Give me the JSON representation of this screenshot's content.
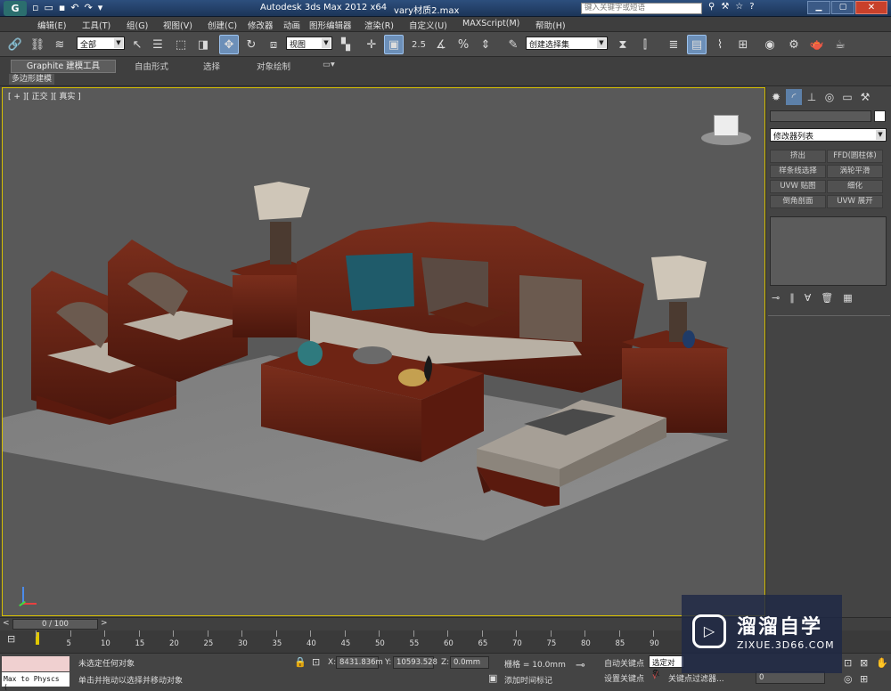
{
  "titlebar": {
    "app_title": "Autodesk 3ds Max  2012 x64",
    "file_name": "vary材质2.max",
    "search_placeholder": "键入关键字或短语"
  },
  "menu": {
    "items": [
      "编辑(E)",
      "工具(T)",
      "组(G)",
      "视图(V)",
      "创建(C)",
      "修改器",
      "动画",
      "图形编辑器",
      "渲染(R)",
      "自定义(U)",
      "MAXScript(M)",
      "帮助(H)"
    ]
  },
  "toolbar": {
    "selection_filter": "全部",
    "coord_system": "视图",
    "named_selection": "创建选择集",
    "snap_value": "2.5"
  },
  "ribbon": {
    "tabs": [
      "Graphite 建模工具",
      "自由形式",
      "选择",
      "对象绘制"
    ],
    "active_tab": "Graphite 建模工具",
    "sub_label": "多边形建模"
  },
  "viewport": {
    "label": "[ + ][ 正交 ][ 真实 ]"
  },
  "command_panel": {
    "modifier_list": "修改器列表",
    "buttons": [
      "挤出",
      "FFD(圆柱体)",
      "样条线选择",
      "涡轮平滑",
      "UVW 贴图",
      "细化",
      "倒角剖面",
      "UVW 展开"
    ]
  },
  "timeline": {
    "frame": "0 / 100",
    "ticks": [
      "0",
      "5",
      "10",
      "15",
      "20",
      "25",
      "30",
      "35",
      "40",
      "45",
      "50",
      "55",
      "60",
      "65",
      "70",
      "75",
      "80",
      "85",
      "90"
    ]
  },
  "status": {
    "script_listener": "Max to Physcs (",
    "selection_status": "未选定任何对象",
    "prompt": "单击并拖动以选择并移动对象",
    "x_label": "X:",
    "x_value": "8431.836m",
    "y_label": "Y:",
    "y_value": "10593.528",
    "z_label": "Z:",
    "z_value": "0.0mm",
    "grid": "栅格 = 10.0mm",
    "add_time_tag": "添加时间标记",
    "auto_key": "自动关键点",
    "set_key": "设置关键点",
    "selected": "选定对象",
    "key_filters": "关键点过滤器...",
    "frame_value": "0"
  },
  "watermark": {
    "brand": "溜溜自学",
    "url": "ZIXUE.3D66.COM"
  },
  "colors": {
    "viewport_border": "#d7c000",
    "active_button": "#6c8fb8",
    "title_bar": "#2d4f7d"
  }
}
